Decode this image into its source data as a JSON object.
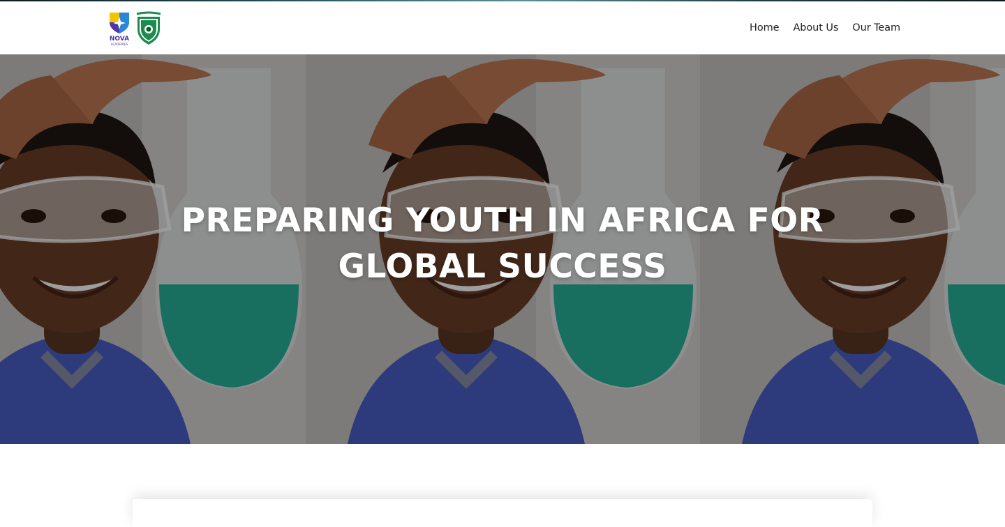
{
  "brand": {
    "logo_primary_text": "NOVA",
    "logo_primary_subtext": "ACADEMIES",
    "logo_secondary_icon": "shield-crest-icon",
    "colors": {
      "nova_purple": "#4b3aa6",
      "nova_yellow": "#f5c400",
      "nova_blue": "#2a86d6",
      "crest_green": "#1d8b4f"
    }
  },
  "nav": {
    "items": [
      {
        "label": "Home"
      },
      {
        "label": "About Us"
      },
      {
        "label": "Our Team"
      }
    ]
  },
  "hero": {
    "title_line1": "PREPARING YOUTH IN AFRICA FOR",
    "title_line2": "GLOBAL SUCCESS",
    "image_subject": "student-with-safety-goggles-image",
    "overlay_color": "rgba(0,0,0,0.38)"
  }
}
